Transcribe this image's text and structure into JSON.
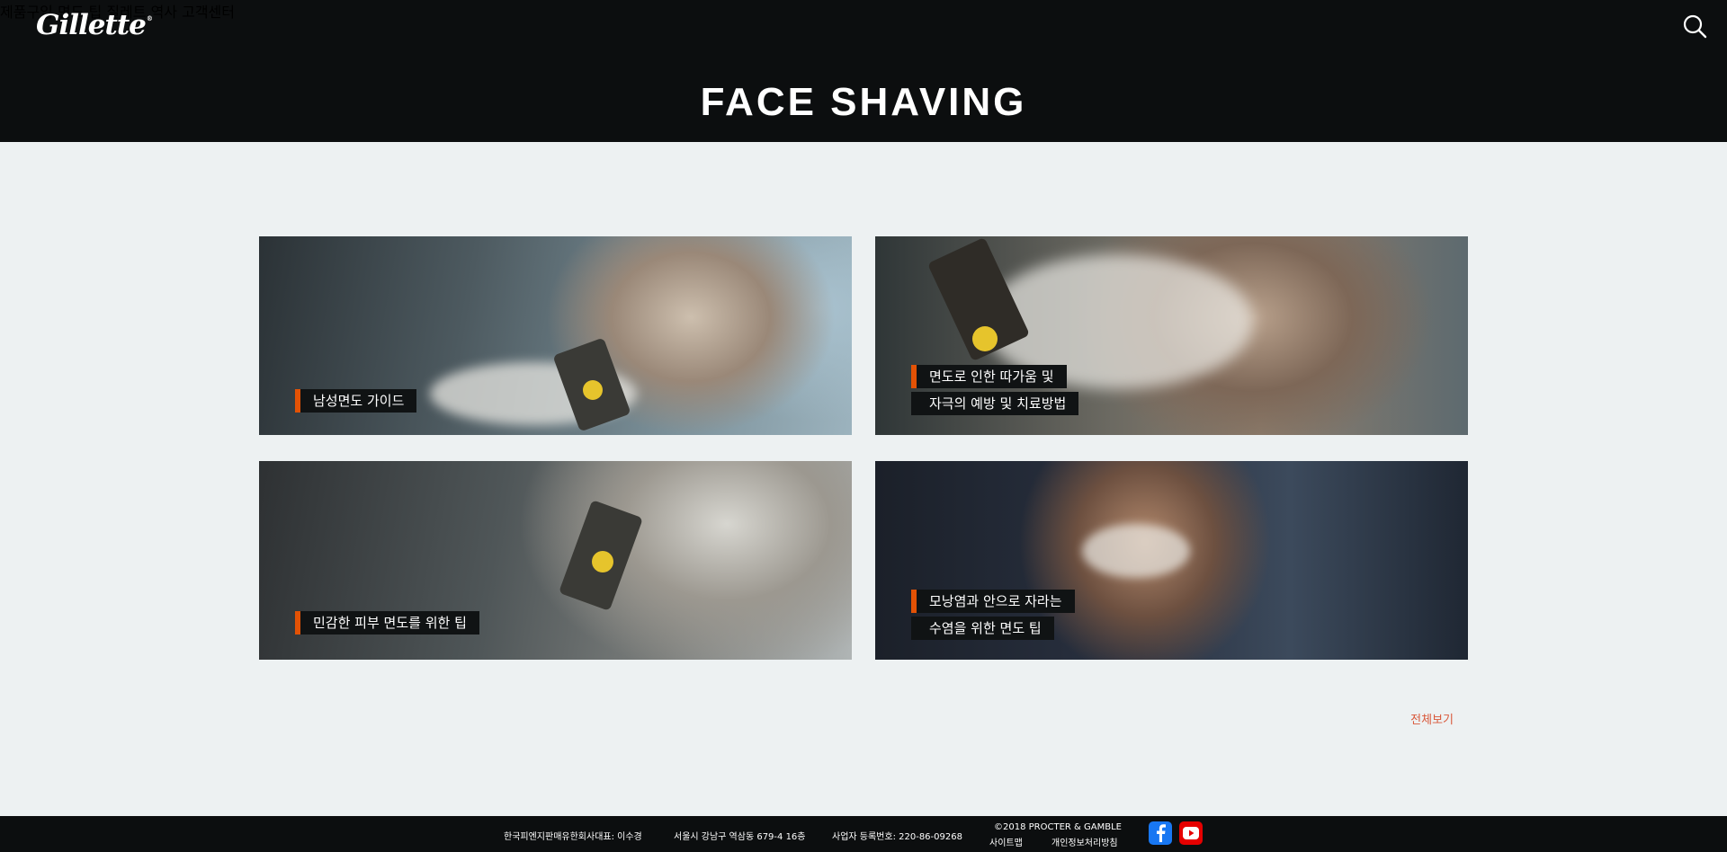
{
  "header": {
    "logo_text": "Gillette",
    "logo_mark": "®",
    "nav": [
      "제품구입",
      "면도 팁",
      "질레트 역사",
      "고객센터"
    ],
    "search_icon": "search-icon"
  },
  "hero": {
    "title": "FACE SHAVING"
  },
  "cards": [
    {
      "lines": [
        "남성면도 가이드"
      ]
    },
    {
      "lines": [
        "면도로 인한 따가움 및",
        "자극의 예방 및 치료방법"
      ]
    },
    {
      "lines": [
        "민감한 피부 면도를 위한 팁"
      ]
    },
    {
      "lines": [
        "모낭염과 안으로 자라는",
        "수염을 위한 면도 팁"
      ]
    }
  ],
  "view_all": "전체보기",
  "footer": {
    "company": "한국피엔지판매유한회사대표: 이수경",
    "address": "서울시 강남구 역삼동 679-4 16층",
    "business_no": "사업자 등록번호: 220-86-09268",
    "copyright": "©2018 PROCTER & GAMBLE",
    "sitemap": "사이트맵",
    "privacy": "개인정보처리방침"
  },
  "colors": {
    "accent": "#e35205",
    "dark": "#0c0e0f",
    "page_bg": "#edf1f2",
    "link": "#d9583a",
    "facebook": "#1877f2",
    "youtube": "#e60000"
  }
}
